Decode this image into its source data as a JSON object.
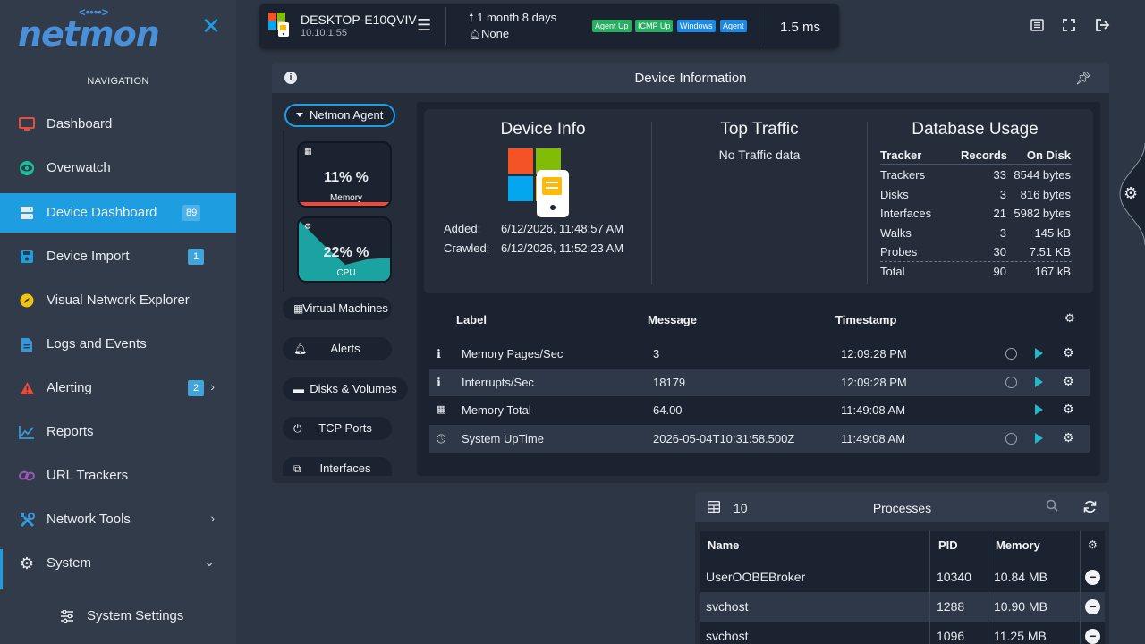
{
  "app": {
    "logo_text": "netmon",
    "logo_dots": "<••••>"
  },
  "sidebar": {
    "nav_heading": "NAVIGATION",
    "items": [
      {
        "label": "Dashboard",
        "icon": "monitor-icon",
        "color": "#e74c3c"
      },
      {
        "label": "Overwatch",
        "icon": "eye-icon",
        "color": "#1abc9c"
      },
      {
        "label": "Device Dashboard",
        "icon": "server-icon",
        "badge": "89",
        "active": true
      },
      {
        "label": "Device Import",
        "icon": "floppy-icon",
        "badge": "1",
        "color": "#1e9de0"
      },
      {
        "label": "Visual Network Explorer",
        "icon": "compass-icon",
        "color": "#f1c40f"
      },
      {
        "label": "Logs and Events",
        "icon": "file-icon",
        "color": "#3498db"
      },
      {
        "label": "Alerting",
        "icon": "warning-icon",
        "badge": "2",
        "color": "#e74c3c"
      },
      {
        "label": "Reports",
        "icon": "chart-line-icon",
        "color": "#3498db"
      },
      {
        "label": "URL Trackers",
        "icon": "link-icon",
        "color": "#9b59b6"
      },
      {
        "label": "Network Tools",
        "icon": "tools-icon",
        "color": "#3498db"
      },
      {
        "label": "System",
        "icon": "gear-icon",
        "color": "#e8ecf2"
      },
      {
        "label": "System Settings",
        "icon": "sliders-icon",
        "color": "#e8ecf2"
      }
    ]
  },
  "topbar": {
    "device_name": "DESKTOP-E10QVIV",
    "device_ip": "10.10.1.55",
    "uptime": "1 month 8 days",
    "alerts": "None",
    "tags": [
      {
        "label": "Agent Up",
        "color": "#27ae60"
      },
      {
        "label": "ICMP Up",
        "color": "#27ae60"
      },
      {
        "label": "Windows",
        "color": "#1e88e5"
      },
      {
        "label": "Agent",
        "color": "#1e88e5"
      }
    ],
    "ping": "1.5 ms"
  },
  "device_panel": {
    "title": "Device Information",
    "agent_button": "Netmon Agent",
    "memory": {
      "value": "11% %",
      "caption": "Memory",
      "percent": 11
    },
    "cpu": {
      "value": "22% %",
      "caption": "CPU",
      "percent": 22
    },
    "menu": [
      "Virtual Machines",
      "Alerts",
      "Disks & Volumes",
      "TCP Ports",
      "Interfaces"
    ]
  },
  "device_info": {
    "title": "Device Info",
    "added_label": "Added:",
    "added_value": "6/12/2026, 11:48:57 AM",
    "crawled_label": "Crawled:",
    "crawled_value": "6/12/2026, 11:52:23 AM"
  },
  "top_traffic": {
    "title": "Top Traffic",
    "message": "No Traffic data"
  },
  "database_usage": {
    "title": "Database Usage",
    "headers": [
      "Tracker",
      "Records",
      "On Disk"
    ],
    "rows": [
      [
        "Trackers",
        "33",
        "8544 bytes"
      ],
      [
        "Disks",
        "3",
        "816 bytes"
      ],
      [
        "Interfaces",
        "21",
        "5982 bytes"
      ],
      [
        "Walks",
        "3",
        "145 kB"
      ],
      [
        "Probes",
        "30",
        "7.51 KB"
      ],
      [
        "Total",
        "90",
        "167 kB"
      ]
    ]
  },
  "probes_table": {
    "headers": [
      "Label",
      "Message",
      "Timestamp"
    ],
    "rows": [
      {
        "icon": "info-icon",
        "label": "Memory Pages/Sec",
        "message": "3",
        "timestamp": "12:09:28 PM",
        "circle": true
      },
      {
        "icon": "info-icon",
        "label": "Interrupts/Sec",
        "message": "18179",
        "timestamp": "12:09:28 PM",
        "circle": true
      },
      {
        "icon": "memory-icon",
        "label": "Memory Total",
        "message": "64.00",
        "timestamp": "11:49:08 AM",
        "circle": false
      },
      {
        "icon": "clock-icon",
        "label": "System UpTime",
        "message": "2026-05-04T10:31:58.500Z",
        "timestamp": "11:49:08 AM",
        "circle": true
      }
    ]
  },
  "processes": {
    "title": "Processes",
    "count": "10",
    "headers": [
      "Name",
      "PID",
      "Memory"
    ],
    "rows": [
      [
        "UserOOBEBroker",
        "10340",
        "10.84 MB"
      ],
      [
        "svchost",
        "1288",
        "10.90 MB"
      ],
      [
        "svchost",
        "1096",
        "11.25 MB"
      ]
    ]
  }
}
